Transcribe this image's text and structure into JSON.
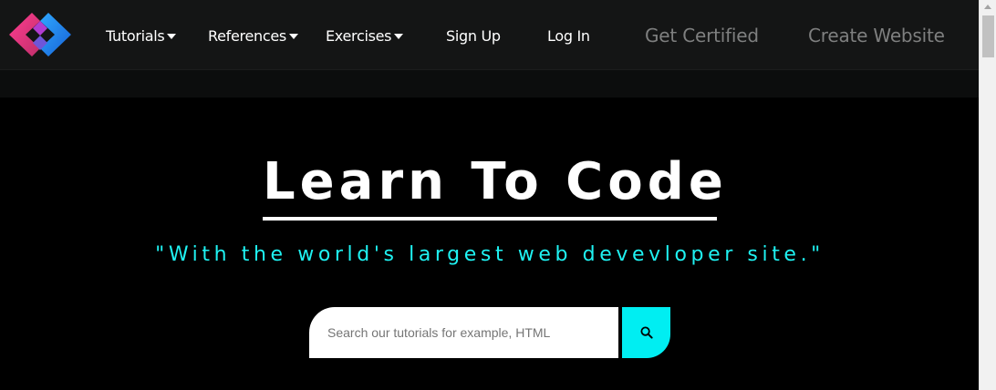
{
  "nav": {
    "tutorials": "Tutorials",
    "references": "References",
    "exercises": "Exercises",
    "sign_up": "Sign Up",
    "log_in": "Log In",
    "get_certified": "Get Certified",
    "create_website": "Create Website"
  },
  "hero": {
    "title": "Learn To Code",
    "subtitle": "\"With the world's largest web devevloper site.\""
  },
  "search": {
    "placeholder": "Search our tutorials for example, HTML",
    "value": ""
  },
  "icons": {
    "logo": "logo-icon",
    "caret": "caret-down-icon",
    "search": "search-icon"
  },
  "colors": {
    "background": "#000000",
    "nav_background": "#141515",
    "accent": "#1ff2f2",
    "search_button": "#00eef2",
    "muted_nav": "#7e7f7f"
  }
}
